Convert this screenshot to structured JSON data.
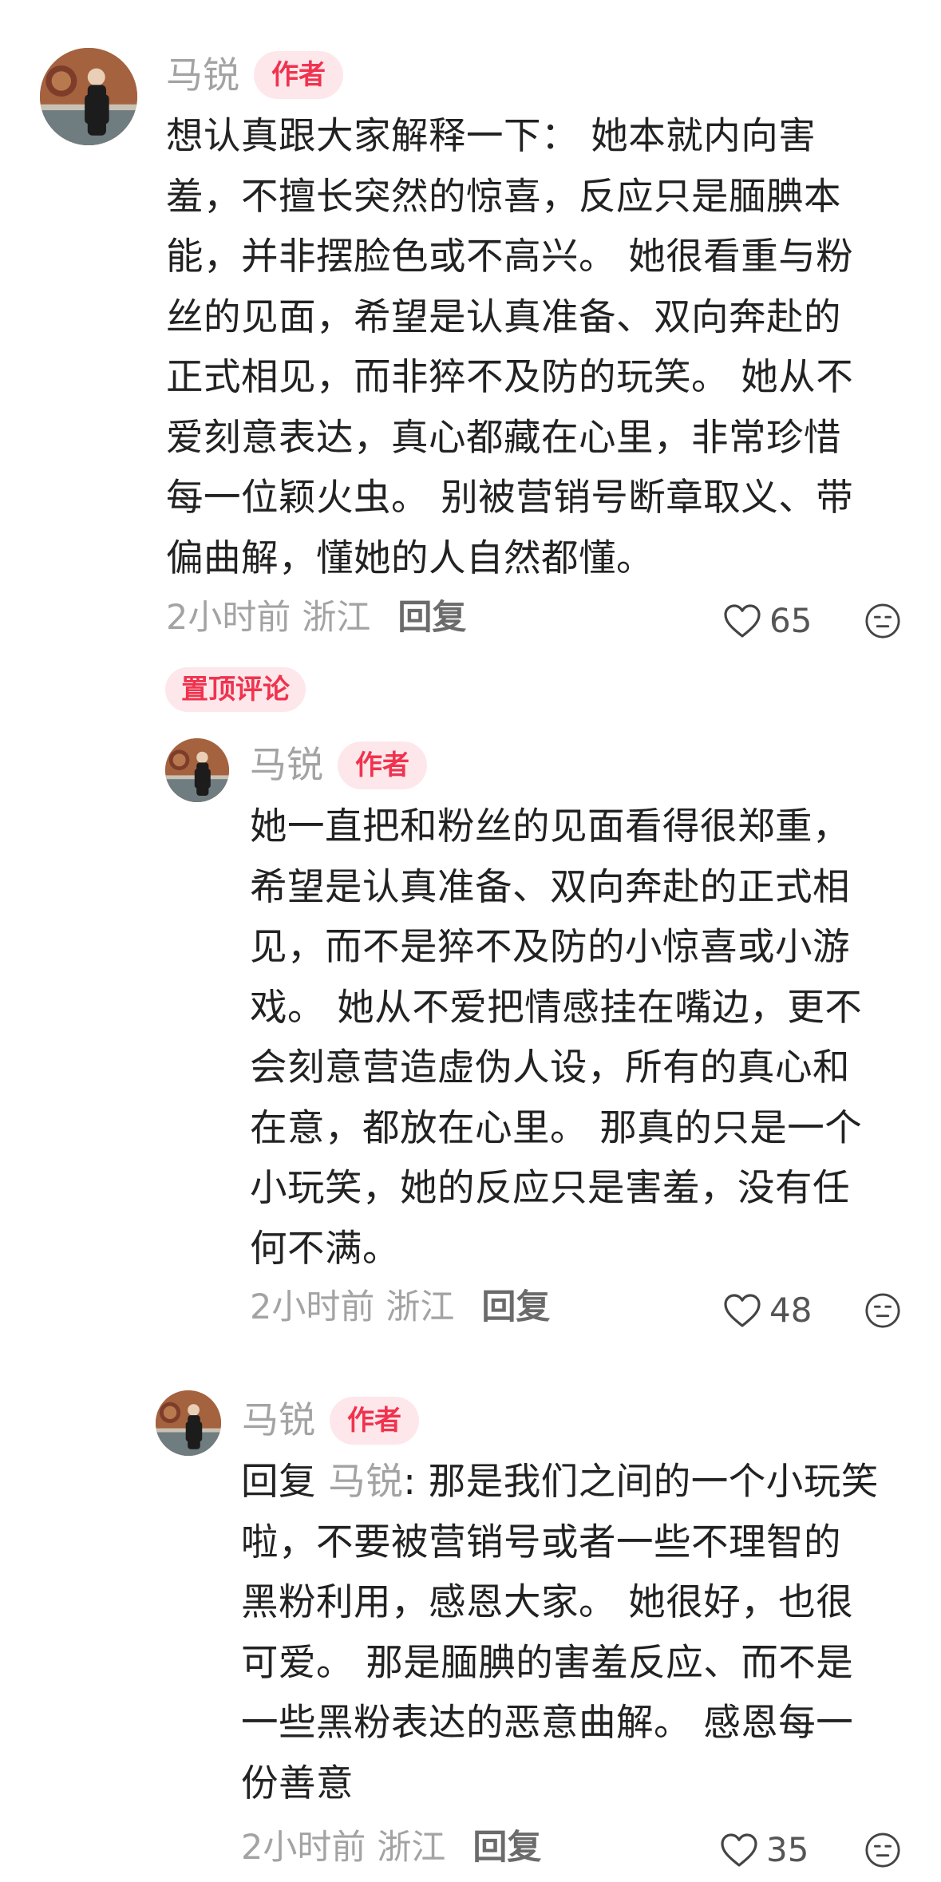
{
  "comments": [
    {
      "name": "马锐",
      "badge": "作者",
      "lines": "想认真跟大家解释一下： 她本就内向害\n羞，不擅长突然的惊喜，反应只是腼腆本\n能，并非摆脸色或不高兴。 她很看重与粉\n丝的见面，希望是认真准备、双向奔赴的\n正式相见，而非猝不及防的玩笑。 她从不\n爱刻意表达，真心都藏在心里，非常珍惜\n每一位颖火虫。 别被营销号断章取义、带\n偏曲解，懂她的人自然都懂。",
      "time": "2小时前",
      "location": "浙江",
      "reply_label": "回复",
      "likes": "65",
      "pinned_label": "置顶评论"
    },
    {
      "name": "马锐",
      "badge": "作者",
      "lines": "她一直把和粉丝的见面看得很郑重，\n希望是认真准备、双向奔赴的正式相\n见，而不是猝不及防的小惊喜或小游\n戏。 她从不爱把情感挂在嘴边，更不\n会刻意营造虚伪人设，所有的真心和\n在意，都放在心里。 那真的只是一个\n小玩笑，她的反应只是害羞，没有任\n何不满。",
      "time": "2小时前",
      "location": "浙江",
      "reply_label": "回复",
      "likes": "48"
    },
    {
      "name": "马锐",
      "badge": "作者",
      "reply_prefix": "回复",
      "reply_to": "马锐",
      "lines_first": ": 那是我们之间的一个小玩笑",
      "lines_rest": "啦，不要被营销号或者一些不理智的\n黑粉利用，感恩大家。 她很好，也很\n可爱。 那是腼腆的害羞反应、而不是\n一些黑粉表达的恶意曲解。 感恩每一\n份善意",
      "time": "2小时前",
      "location": "浙江",
      "reply_label": "回复",
      "likes": "35"
    }
  ],
  "icons": {
    "like": "heart-outline-icon",
    "emoji": "meh-face-icon"
  },
  "colors": {
    "accent": "#f0334f",
    "badge_bg": "#fde7ea",
    "muted": "#a3a3a3",
    "text": "#222222"
  }
}
